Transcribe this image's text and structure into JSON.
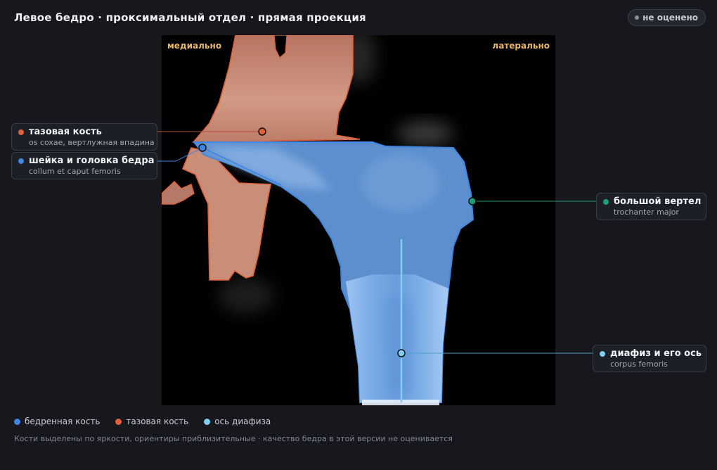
{
  "header": {
    "title": "Левое бедро · проксимальный отдел · прямая проекция",
    "status_label": "не оценено"
  },
  "image": {
    "orientation_left": "медиально",
    "orientation_right": "латерально"
  },
  "callouts": [
    {
      "name": "тазовая кость",
      "latin": "os coxae, вертлужная впадина",
      "color": "#e0603a"
    },
    {
      "name": "шейка и головка бедра",
      "latin": "collum et caput femoris",
      "color": "#3f86e0"
    },
    {
      "name": "большой вертел",
      "latin": "trochanter major",
      "color": "#1e9e72"
    },
    {
      "name": "диафиз и его ось",
      "latin": "corpus femoris",
      "color": "#7fd0f5"
    }
  ],
  "legend": [
    {
      "label": "бедренная кость",
      "color": "#3f86e0"
    },
    {
      "label": "тазовая кость",
      "color": "#e0603a"
    },
    {
      "label": "ось диафиза",
      "color": "#7fd0f5"
    }
  ],
  "footnote": "Кости выделены по яркости, ориентиры приблизительные · качество бедра в этой версии не оценивается",
  "colors": {
    "background": "#16181d",
    "femur": "#3f86e0",
    "pelvis": "#e0603a",
    "axis": "#7fd0f5",
    "trochanter": "#1e9e72",
    "orientation_text": "#e8b66a"
  },
  "icons": [
    "status-dot-icon",
    "landmark-marker-icon",
    "legend-dot-icon"
  ]
}
